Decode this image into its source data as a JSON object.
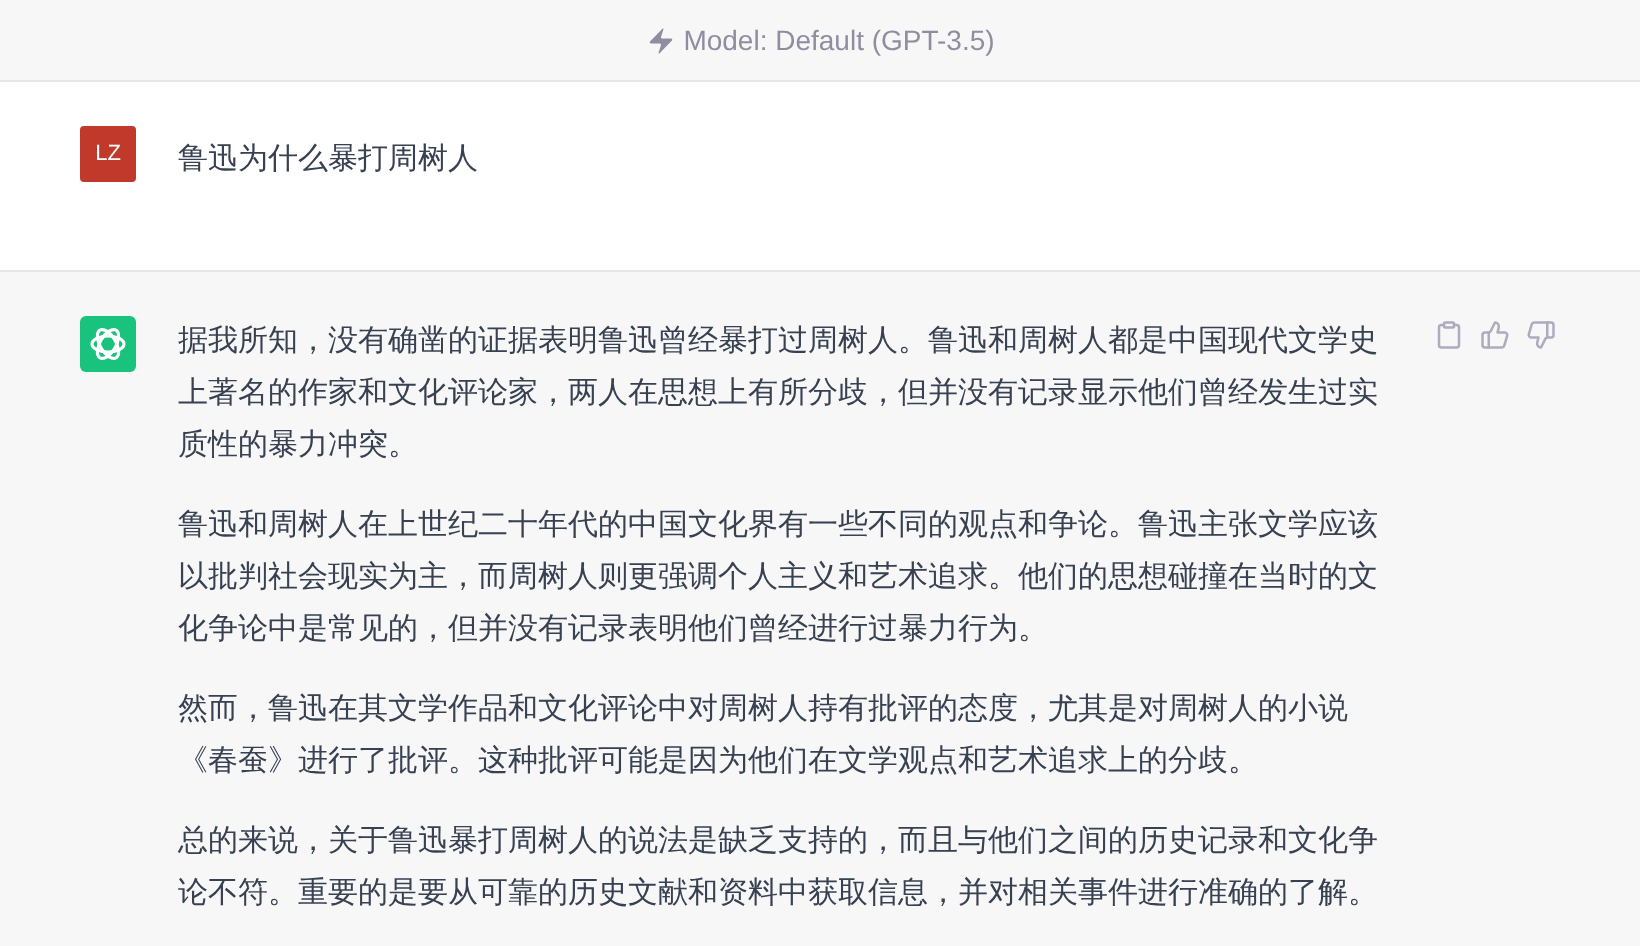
{
  "header": {
    "model_label": "Model: Default (GPT-3.5)"
  },
  "messages": [
    {
      "kind": "user",
      "avatar": "LZ",
      "paragraphs": [
        "鲁迅为什么暴打周树人"
      ]
    },
    {
      "kind": "assistant",
      "paragraphs": [
        "据我所知，没有确凿的证据表明鲁迅曾经暴打过周树人。鲁迅和周树人都是中国现代文学史上著名的作家和文化评论家，两人在思想上有所分歧，但并没有记录显示他们曾经发生过实质性的暴力冲突。",
        "鲁迅和周树人在上世纪二十年代的中国文化界有一些不同的观点和争论。鲁迅主张文学应该以批判社会现实为主，而周树人则更强调个人主义和艺术追求。他们的思想碰撞在当时的文化争论中是常见的，但并没有记录表明他们曾经进行过暴力行为。",
        "然而，鲁迅在其文学作品和文化评论中对周树人持有批评的态度，尤其是对周树人的小说《春蚕》进行了批评。这种批评可能是因为他们在文学观点和艺术追求上的分歧。",
        "总的来说，关于鲁迅暴打周树人的说法是缺乏支持的，而且与他们之间的历史记录和文化争论不符。重要的是要从可靠的历史文献和资料中获取信息，并对相关事件进行准确的了解。"
      ]
    }
  ]
}
